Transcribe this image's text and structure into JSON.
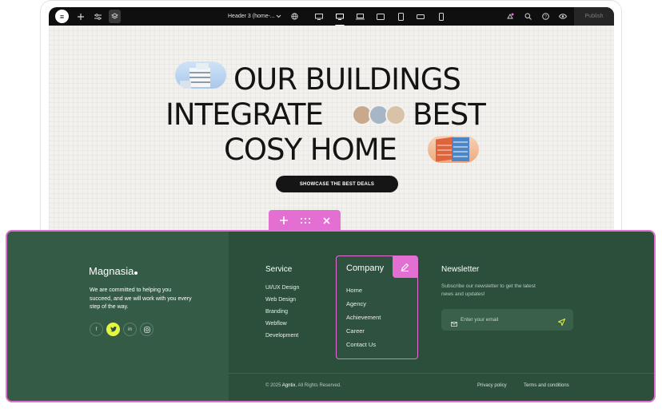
{
  "toolbar": {
    "page_title": "Header 3 (home-...",
    "publish_label": "Publish"
  },
  "hero": {
    "line1": "OUR BUILDINGS",
    "line2a": "INTEGRATE",
    "line2b": "BEST",
    "line3": "COSY HOME",
    "cta_label": "SHOWCASE THE BEST DEALS"
  },
  "footer": {
    "brand": "Magnasia",
    "about": "We are committed to helping you succeed, and we will work with you every step of the way.",
    "socials": [
      {
        "label": "f",
        "icon": "facebook-icon"
      },
      {
        "label": "t",
        "icon": "twitter-icon"
      },
      {
        "label": "in",
        "icon": "linkedin-icon"
      },
      {
        "label": "ig",
        "icon": "instagram-icon"
      }
    ],
    "service": {
      "title": "Service",
      "items": [
        "UI/UX Design",
        "Web Design",
        "Branding",
        "Webflow",
        "Development"
      ]
    },
    "company": {
      "title": "Company",
      "items": [
        "Home",
        "Agency",
        "Achievement",
        "Career",
        "Contact Us"
      ]
    },
    "newsletter": {
      "title": "Newsletter",
      "text": "Subscribe our newsletter to get the latest news and updates!",
      "placeholder": "Enter your email"
    },
    "copyright_prefix": "© 2025 ",
    "copyright_brand": "Agntix.",
    "copyright_suffix": " All Rights Reserved.",
    "privacy": "Privacy policy",
    "terms": "Terms and conditions"
  },
  "colors": {
    "accent": "#e46fd3",
    "footer_bg": "#2c4f3c",
    "footer_left_bg": "#345b45",
    "highlight": "#e4f542"
  }
}
